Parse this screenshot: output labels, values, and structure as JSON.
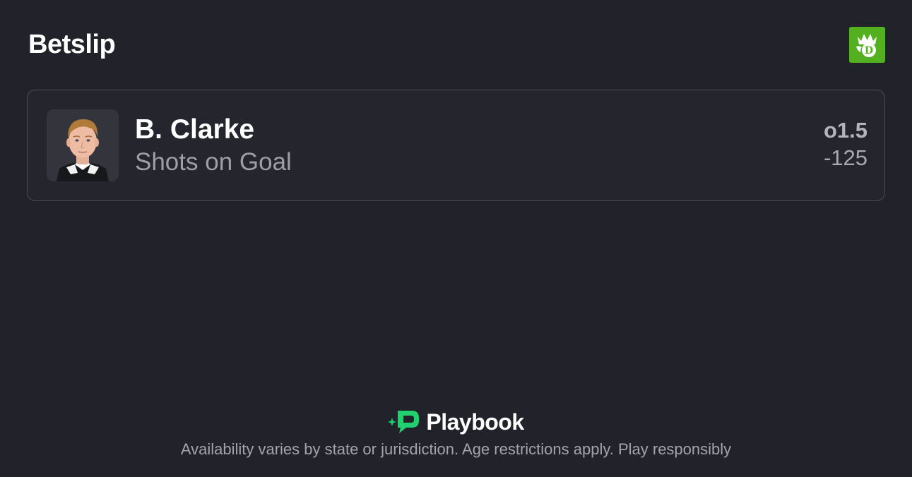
{
  "header": {
    "title": "Betslip",
    "brand_icon": "draftkings-crown-logo",
    "brand_color": "#53b11f"
  },
  "bet": {
    "avatar_icon": "player-headshot",
    "player_name": "B. Clarke",
    "market": "Shots on Goal",
    "line": "o1.5",
    "odds": "-125"
  },
  "footer": {
    "logo_icon": "playbook-logo",
    "logo_text": "Playbook",
    "logo_accent": "#1fd26f",
    "disclaimer": "Availability varies by state or jurisdiction. Age restrictions apply. Play responsibly"
  },
  "colors": {
    "background": "#22232a",
    "card_border": "#4b4c54",
    "muted_text": "#9d9ea6"
  }
}
